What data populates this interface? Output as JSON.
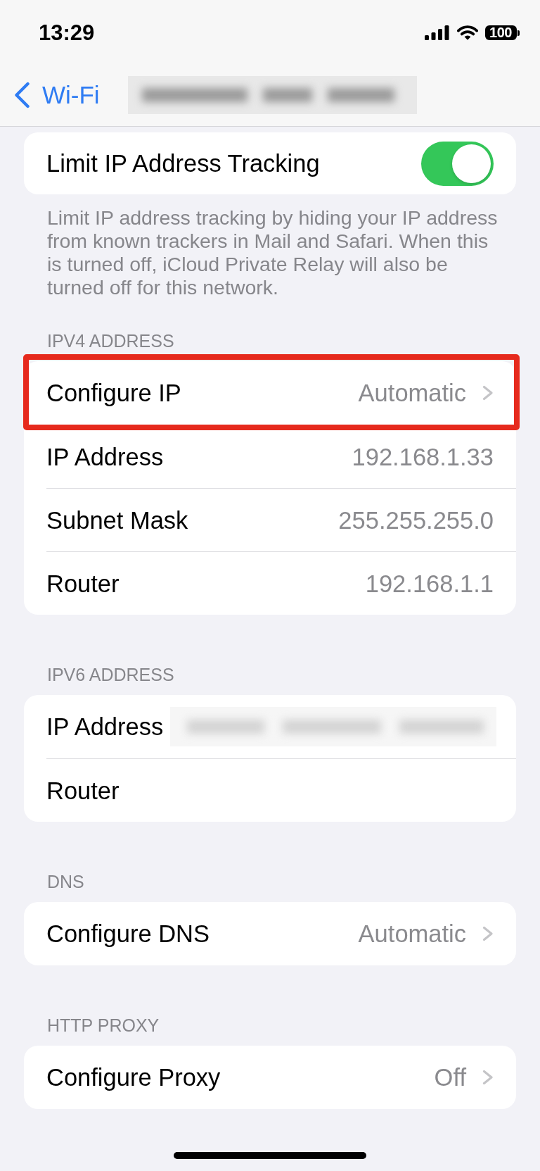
{
  "status_bar": {
    "time": "13:29",
    "battery": "100"
  },
  "nav": {
    "back_label": "Wi-Fi",
    "title_blurred": true
  },
  "tracking": {
    "label": "Limit IP Address Tracking",
    "on": true,
    "footer": "Limit IP address tracking by hiding your IP address from known trackers in Mail and Safari. When this is turned off, iCloud Private Relay will also be turned off for this network."
  },
  "sections": [
    {
      "header": "IPV4 ADDRESS",
      "rows": [
        {
          "kind": "link",
          "label": "Configure IP",
          "value": "Automatic",
          "highlighted": true
        },
        {
          "kind": "info",
          "label": "IP Address",
          "value": "192.168.1.33",
          "highlighted": false
        },
        {
          "kind": "info",
          "label": "Subnet Mask",
          "value": "255.255.255.0",
          "highlighted": false
        },
        {
          "kind": "info",
          "label": "Router",
          "value": "192.168.1.1",
          "highlighted": false
        }
      ]
    },
    {
      "header": "IPV6 ADDRESS",
      "rows": [
        {
          "kind": "blurred",
          "label": "IP Address",
          "highlighted": false
        },
        {
          "kind": "info",
          "label": "Router",
          "highlighted": false
        }
      ]
    },
    {
      "header": "DNS",
      "rows": [
        {
          "kind": "link",
          "label": "Configure DNS",
          "value": "Automatic",
          "highlighted": false
        }
      ]
    },
    {
      "header": "HTTP PROXY",
      "rows": [
        {
          "kind": "link",
          "label": "Configure Proxy",
          "value": "Off",
          "highlighted": false
        }
      ]
    }
  ]
}
